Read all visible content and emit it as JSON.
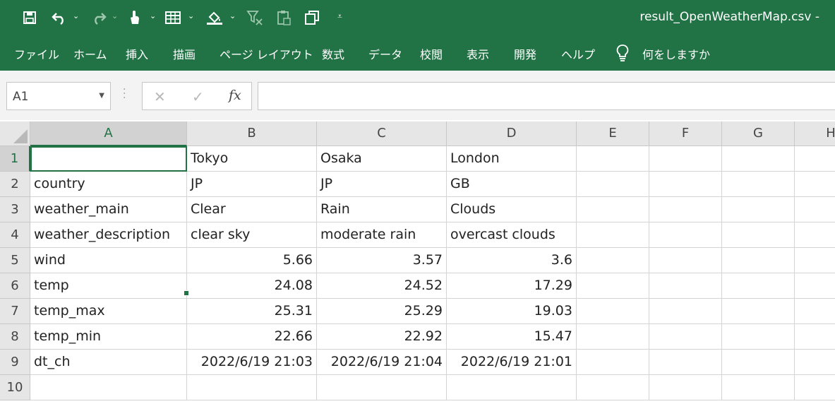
{
  "window": {
    "title": "result_OpenWeatherMap.csv  -"
  },
  "ribbon_tabs": [
    "ファイル",
    "ホーム",
    "挿入",
    "描画",
    "ページ レイアウト",
    "数式",
    "データ",
    "校閲",
    "表示",
    "開発",
    "ヘルプ"
  ],
  "tell_me": "何をしますか",
  "name_box": {
    "value": "A1"
  },
  "formula_bar": {
    "value": "",
    "fx_label": "fx"
  },
  "columns": [
    "A",
    "B",
    "C",
    "D",
    "E",
    "F",
    "G",
    "H"
  ],
  "rows": [
    "1",
    "2",
    "3",
    "4",
    "5",
    "6",
    "7",
    "8",
    "9",
    "10"
  ],
  "cells": [
    [
      "",
      "Tokyo",
      "Osaka",
      "London"
    ],
    [
      "country",
      "JP",
      "JP",
      "GB"
    ],
    [
      "weather_main",
      "Clear",
      "Rain",
      "Clouds"
    ],
    [
      "weather_description",
      "clear sky",
      "moderate rain",
      "overcast clouds"
    ],
    [
      "wind",
      "5.66",
      "3.57",
      "3.6"
    ],
    [
      "temp",
      "24.08",
      "24.52",
      "17.29"
    ],
    [
      "temp_max",
      "25.31",
      "25.29",
      "19.03"
    ],
    [
      "temp_min",
      "22.66",
      "22.92",
      "15.47"
    ],
    [
      "dt_ch",
      "2022/6/19 21:03",
      "2022/6/19 21:04",
      "2022/6/19 21:01"
    ],
    [
      "",
      "",
      "",
      ""
    ]
  ],
  "colors": {
    "accent": "#217346",
    "header_bg": "#e6e6e6",
    "gridline": "#d4d4d4"
  }
}
